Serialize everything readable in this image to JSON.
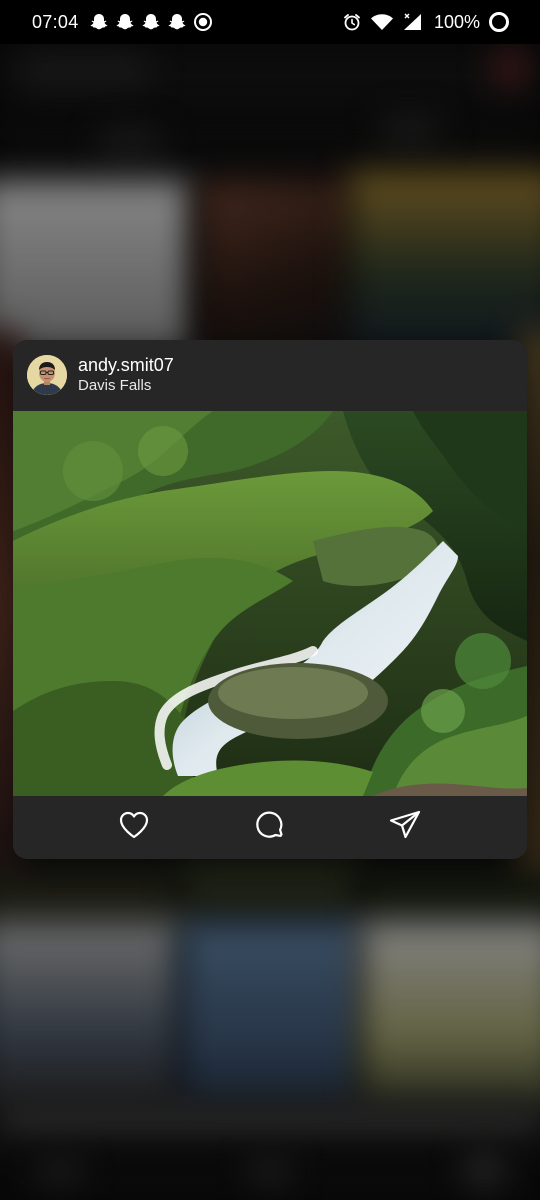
{
  "status_bar": {
    "time": "07:04",
    "left_icons": [
      "snapchat-icon",
      "snapchat-icon",
      "snapchat-icon",
      "snapchat-icon",
      "record-icon"
    ],
    "right_icons": [
      "alarm-icon",
      "wifi-icon",
      "signal-icon",
      "battery-icon"
    ],
    "battery": "100%"
  },
  "post": {
    "username": "andy.smit07",
    "location": "Davis Falls",
    "image_icon": "waterfall-photo",
    "actions": [
      {
        "name": "like",
        "icon": "heart-icon"
      },
      {
        "name": "comment",
        "icon": "comment-icon"
      },
      {
        "name": "share",
        "icon": "send-icon"
      }
    ]
  },
  "colors": {
    "card_background": "#262626",
    "status_bar_background": "#000000",
    "text_primary": "#ffffff"
  }
}
